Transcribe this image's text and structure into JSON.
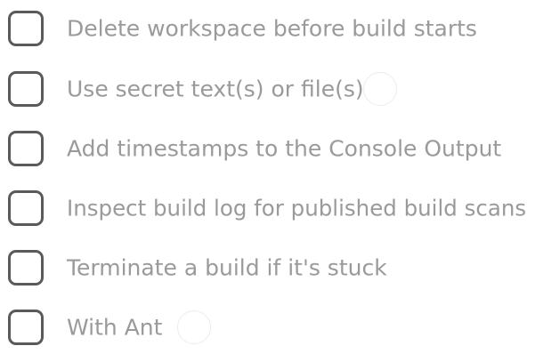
{
  "options": [
    {
      "label": "Delete workspace before build starts",
      "checked": false,
      "has_help": false
    },
    {
      "label": "Use secret text(s) or file(s)",
      "checked": false,
      "has_help": true,
      "help_icon": "help-circle-icon"
    },
    {
      "label": "Add timestamps to the Console Output",
      "checked": false,
      "has_help": false
    },
    {
      "label": "Inspect build log for published build scans",
      "checked": false,
      "has_help": false
    },
    {
      "label": "Terminate a build if it's stuck",
      "checked": false,
      "has_help": false
    },
    {
      "label": "With Ant",
      "checked": false,
      "has_help": true,
      "help_icon": "help-circle-icon"
    }
  ],
  "colors": {
    "checkbox_border": "#5a5a5a",
    "label_text": "#9a9a9a",
    "help_border": "#ececec",
    "background": "#ffffff"
  }
}
